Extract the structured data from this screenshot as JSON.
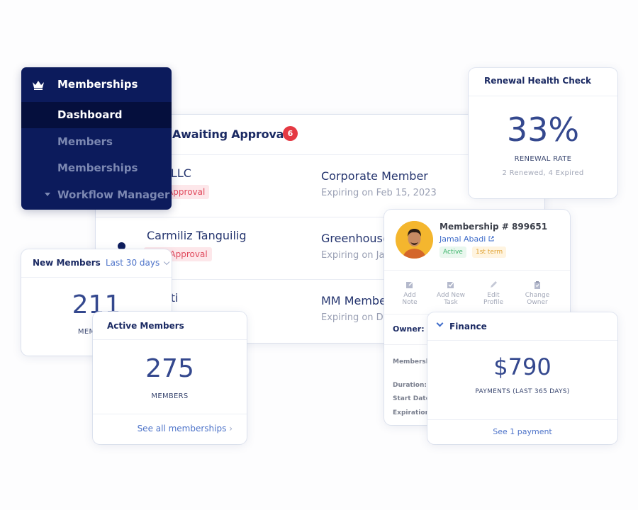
{
  "sidebar": {
    "brand_label": "Memberships",
    "brand_icon": "crown-icon",
    "items": [
      {
        "label": "Dashboard",
        "active": true
      },
      {
        "label": "Members",
        "active": false
      },
      {
        "label": "Memberships",
        "active": false
      },
      {
        "label": "Workflow Manager",
        "active": false,
        "expandable": true
      }
    ]
  },
  "awaiting": {
    "title": "Awaiting Approval",
    "count": "6",
    "rows": [
      {
        "name": "lion LLC",
        "status": "ting Approval",
        "plan": "Corporate Member",
        "expiry": "Expiring on Feb 15, 2023"
      },
      {
        "name": "Carmiliz Tanguilig",
        "status": "iting Approval",
        "plan": "Greenhouse",
        "expiry": "Expiring on Ja"
      },
      {
        "name": "Mauti",
        "status": "",
        "plan": "MM Membe",
        "expiry": "Expiring on D"
      }
    ]
  },
  "new_members": {
    "title": "New Members",
    "range": "Last 30 days",
    "value": "211",
    "caption": "MEMBERS"
  },
  "active_members": {
    "title": "Active Members",
    "value": "275",
    "caption": "MEMBERS",
    "link": "See all memberships"
  },
  "renewal": {
    "title": "Renewal Health Check",
    "value": "33%",
    "caption": "RENEWAL RATE",
    "sub": "2 Renewed, 4 Expired"
  },
  "membership": {
    "number": "Membership # 899651",
    "owner_name": "Jamal Abadi",
    "status": "Active",
    "term": "1st term",
    "actions": [
      {
        "line1": "Add",
        "line2": "Note",
        "icon": "note-icon"
      },
      {
        "line1": "Add New",
        "line2": "Task",
        "icon": "task-icon"
      },
      {
        "line1": "Edit",
        "line2": "Profile",
        "icon": "pencil-icon"
      },
      {
        "line1": "Change",
        "line2": "Owner",
        "icon": "clipboard-icon"
      }
    ],
    "owner_label": "Owner:",
    "labels": [
      "Membershi",
      "Duration:",
      "Start Date:",
      "Expiration I"
    ]
  },
  "finance": {
    "title": "Finance",
    "value": "$790",
    "caption": "PAYMENTS (LAST 365 DAYS)",
    "link": "See 1 payment"
  },
  "colors": {
    "sidebar_bg": "#0c1b5c",
    "sidebar_active": "#050f3d",
    "accent": "#4d73c9",
    "badge_red": "#e53943",
    "number_blue": "#34488e"
  }
}
